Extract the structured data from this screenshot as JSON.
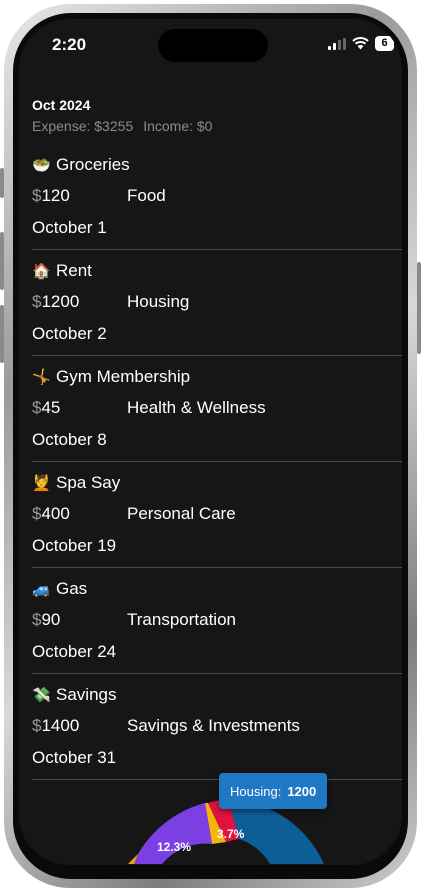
{
  "status": {
    "time": "2:20",
    "battery": "6"
  },
  "header": {
    "month": "Oct 2024",
    "expense": "Expense: $3255",
    "income": "Income: $0"
  },
  "currency_symbol": "$",
  "transactions": [
    {
      "icon": "salad",
      "emoji": "🥗",
      "name": "Groceries",
      "amount": "120",
      "category": "Food",
      "date": "October 1"
    },
    {
      "icon": "house",
      "emoji": "🏠",
      "name": "Rent",
      "amount": "1200",
      "category": "Housing",
      "date": "October 2"
    },
    {
      "icon": "gymnast",
      "emoji": "🤸",
      "name": "Gym Membership",
      "amount": "45",
      "category": "Health & Wellness",
      "date": "October 8"
    },
    {
      "icon": "face-massage",
      "emoji": "💆",
      "name": "Spa Say",
      "amount": "400",
      "category": "Personal Care",
      "date": "October 19"
    },
    {
      "icon": "car",
      "emoji": "🚙",
      "name": "Gas",
      "amount": "90",
      "category": "Transportation",
      "date": "October 24"
    },
    {
      "icon": "money-wings",
      "emoji": "💸",
      "name": "Savings",
      "amount": "1400",
      "category": "Savings & Investments",
      "date": "October 31"
    }
  ],
  "chart_data": {
    "type": "pie",
    "labels": [
      "12.3%",
      "3.7%"
    ],
    "tooltip": {
      "label": "Housing:",
      "value": "1200"
    },
    "colors": {
      "blue": "#0d5d97",
      "red": "#e1123f",
      "yellow": "#f6b30c",
      "purple": "#7b3fe4",
      "orange": "#f5a010"
    }
  }
}
